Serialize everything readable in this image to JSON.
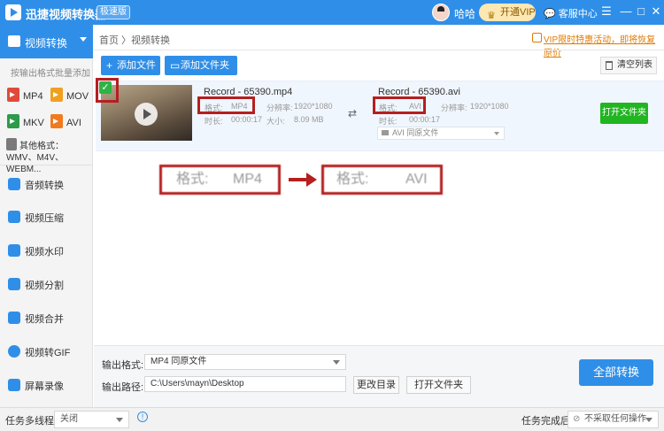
{
  "titlebar": {
    "app_title": "迅捷视频转换器",
    "edition_badge": "极速版",
    "username": "哈哈",
    "vip_button": "开通VIP",
    "service": "客服中心",
    "window_controls": [
      "☰",
      "—",
      "□",
      "✕"
    ]
  },
  "sidebar": {
    "active": "视频转换",
    "hint": "按输出格式批量添加",
    "formats": [
      {
        "label": "MP4",
        "color": "#e04a3b"
      },
      {
        "label": "MOV",
        "color": "#f0a020"
      },
      {
        "label": "MKV",
        "color": "#2c9b4a"
      },
      {
        "label": "AVI",
        "color": "#f07a20"
      }
    ],
    "other_formats": "其他格式：WMV、M4V、WEBM...",
    "nav": [
      "音频转换",
      "视频压缩",
      "视频水印",
      "视频分割",
      "视频合并",
      "视频转GIF",
      "屏幕录像"
    ]
  },
  "main": {
    "breadcrumb": "首页 〉视频转换",
    "promo": "VIP限时特惠活动，即将恢复原价",
    "add_file": "添加文件",
    "add_folder": "添加文件夹",
    "clear_list": "清空列表"
  },
  "file": {
    "source": {
      "name": "Record - 65390.mp4",
      "format_label": "格式:",
      "format": "MP4",
      "resolution_label": "分辨率:",
      "resolution": "1920*1080",
      "duration_label": "时长:",
      "duration": "00:00:17",
      "size_label": "大小:",
      "size": "8.09 MB"
    },
    "target": {
      "name": "Record - 65390.avi",
      "format_label": "格式:",
      "format": "AVI",
      "resolution_label": "分辨率:",
      "resolution": "1920*1080",
      "duration_label": "时长:",
      "duration": "00:00:17",
      "output_select": "AVI  同原文件"
    },
    "open_folder": "打开文件夹"
  },
  "annotation": {
    "left_label": "格式:",
    "left_value": "MP4",
    "right_label": "格式:",
    "right_value": "AVI"
  },
  "bottom": {
    "output_format_label": "输出格式:",
    "output_format_value": "MP4  同原文件",
    "output_path_label": "输出路径:",
    "output_path_value": "C:\\Users\\mayn\\Desktop",
    "change_dir": "更改目录",
    "open_folder": "打开文件夹",
    "convert_all": "全部转换"
  },
  "statusbar": {
    "multithread_label": "任务多线程",
    "multithread_value": "关闭",
    "after_done_label": "任务完成后",
    "after_done_value": "不采取任何操作"
  }
}
